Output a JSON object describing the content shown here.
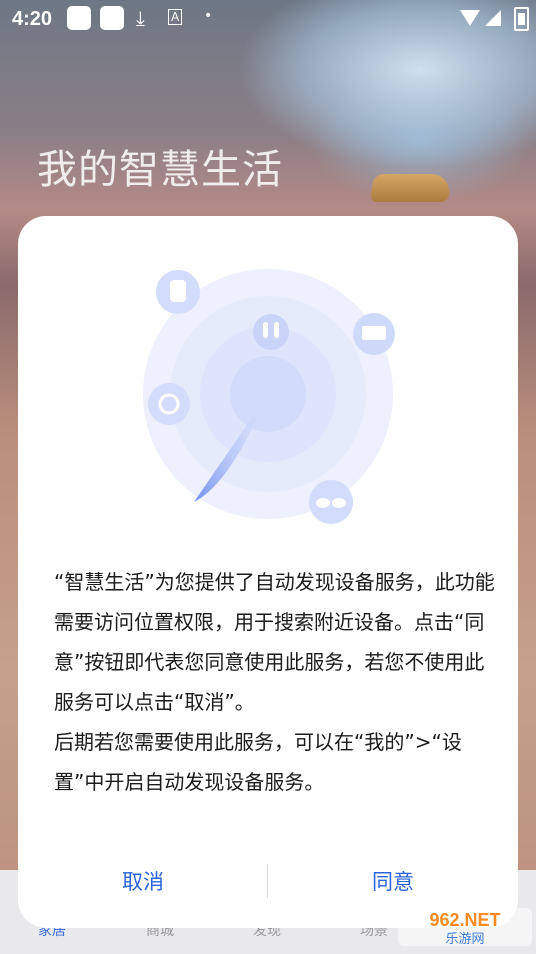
{
  "status_bar": {
    "time": "4:20",
    "icons": [
      "notification-square-icon",
      "notification-square-icon",
      "download-icon",
      "a-icon",
      "dot-icon",
      "wifi-icon",
      "signal-icon",
      "battery-icon"
    ]
  },
  "background": {
    "title": "我的智慧生活"
  },
  "tab_bar": {
    "tabs": [
      {
        "label": "家居",
        "active": true
      },
      {
        "label": "商城",
        "active": false
      },
      {
        "label": "发现",
        "active": false
      },
      {
        "label": "场景",
        "active": false
      }
    ]
  },
  "dialog": {
    "message": "“智慧生活”为您提供了自动发现设备服务，此功能需要访问位置权限，用于搜索附近设备。点击“同意”按钮即代表您同意使用此服务，若您不使用此服务可以点击“取消”。\n后期若您需要使用此服务，可以在“我的”>“设置”中开启自动发现设备服务。",
    "cancel_label": "取消",
    "agree_label": "同意",
    "illustration_icons": [
      "speaker-icon",
      "earbuds-icon",
      "tv-icon",
      "watch-icon",
      "glasses-icon"
    ]
  },
  "watermark": {
    "text_top": "962.NET",
    "text_bottom": "乐游网"
  },
  "colors": {
    "accent": "#2a64dc",
    "dialog_bg": "#ffffff",
    "radar_light": "#eef1fd",
    "radar_mid": "#dde4fb"
  }
}
